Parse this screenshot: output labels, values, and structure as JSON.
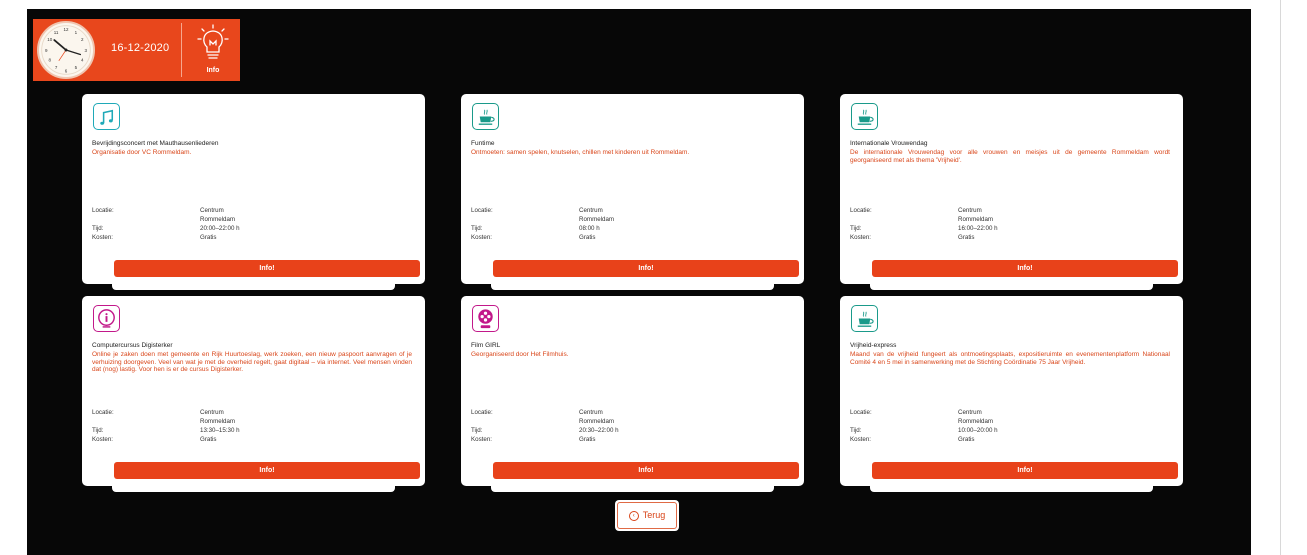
{
  "header": {
    "date": "16-12-2020",
    "info_label": "Info"
  },
  "colors": {
    "accent": "#e8471c",
    "background": "#070707",
    "card": "#ffffff",
    "description": "#d9461a"
  },
  "meta_labels": {
    "location": "Locatie:",
    "time": "Tijd:",
    "cost": "Kosten:"
  },
  "cards": [
    {
      "icon": "music-icon",
      "icon_color": "#1fa9b8",
      "title": "Bevrijdingsconcert met Mauthausenliederen",
      "description": "Organisatie door VC Rommeldam.",
      "location_line1": "Centrum",
      "location_line2": "Rommeldam",
      "time": "20:00–22:00 h",
      "cost": "Gratis",
      "button": "Info!"
    },
    {
      "icon": "coffee-icon",
      "icon_color": "#1a9a8a",
      "title": "Funtime",
      "description": "Ontmoeten: samen spelen, knutselen, chillen met kinderen uit Rommeldam.",
      "location_line1": "Centrum",
      "location_line2": "Rommeldam",
      "time": "08:00 h",
      "cost": "Gratis",
      "button": "Info!"
    },
    {
      "icon": "coffee-icon",
      "icon_color": "#1a9a8a",
      "title": "Internationale Vrouwendag",
      "description": "De internationale Vrouwendag voor alle vrouwen en meisjes uit de gemeente Rommeldam wordt georganiseerd met als thema 'Vrijheid'.",
      "location_line1": "Centrum",
      "location_line2": "Rommeldam",
      "time": "16:00–22:00 h",
      "cost": "Gratis",
      "button": "Info!"
    },
    {
      "icon": "info-icon",
      "icon_color": "#c2188a",
      "title": "Computercursus Digisterker",
      "description": "Online je zaken doen met gemeente en Rijk Huurtoeslag, werk zoeken, een nieuw paspoort aanvragen of je verhuizing doorgeven. Veel van wat je met de overheid regelt, gaat digitaal – via internet. Veel mensen vinden dat (nog) lastig. Voor hen is er de cursus Digisterker.",
      "location_line1": "Centrum",
      "location_line2": "Rommeldam",
      "time": "13:30–15:30 h",
      "cost": "Gratis",
      "button": "Info!"
    },
    {
      "icon": "film-reel-icon",
      "icon_color": "#c2188a",
      "title": "Film GIRL",
      "description": "Georganiseerd door Het Filmhuis.",
      "location_line1": "Centrum",
      "location_line2": "Rommeldam",
      "time": "20:30–22:00 h",
      "cost": "Gratis",
      "button": "Info!"
    },
    {
      "icon": "coffee-icon",
      "icon_color": "#1a9a8a",
      "title": "Vrijheid-express",
      "description": "Maand van de vrijheid fungeert als ontmoetingsplaats, expositieruimte en evenementenplatform Nationaal Comité 4 en 5 mei in samenwerking met de Stichting Coördinatie 75 Jaar Vrijheid.",
      "location_line1": "Centrum",
      "location_line2": "Rommeldam",
      "time": "10:00–20:00 h",
      "cost": "Gratis",
      "button": "Info!"
    }
  ],
  "back_button": {
    "label": "Terug",
    "icon": "back-arrow-icon"
  }
}
